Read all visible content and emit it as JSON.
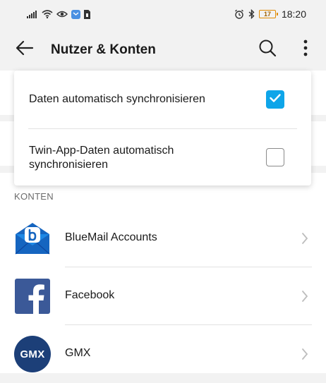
{
  "status_bar": {
    "time": "18:20",
    "battery_level": "17",
    "icons": [
      "signal-icon",
      "wifi-icon",
      "eye-icon",
      "notification-app-icon",
      "sim-icon",
      "alarm-icon",
      "bluetooth-icon",
      "battery-icon"
    ]
  },
  "header": {
    "title": "Nutzer & Konten",
    "icons": [
      "back-arrow-icon",
      "search-icon",
      "more-vert-icon"
    ]
  },
  "sync_popup": {
    "items": [
      {
        "label": "Daten automatisch synchronisieren",
        "checked": true
      },
      {
        "label_line1": "Twin-App-Daten automatisch",
        "label_line2": "synchronisieren",
        "checked": false
      }
    ]
  },
  "accounts": {
    "section_label": "KONTEN",
    "items": [
      {
        "name": "BlueMail Accounts",
        "icon": "bluemail-icon"
      },
      {
        "name": "Facebook",
        "icon": "facebook-icon"
      },
      {
        "name": "GMX",
        "icon": "gmx-icon",
        "icon_text": "GMX"
      }
    ]
  },
  "colors": {
    "accent": "#0ea5e9",
    "bluemail": "#1565c0",
    "facebook": "#3b5998",
    "gmx": "#1c3f78"
  }
}
